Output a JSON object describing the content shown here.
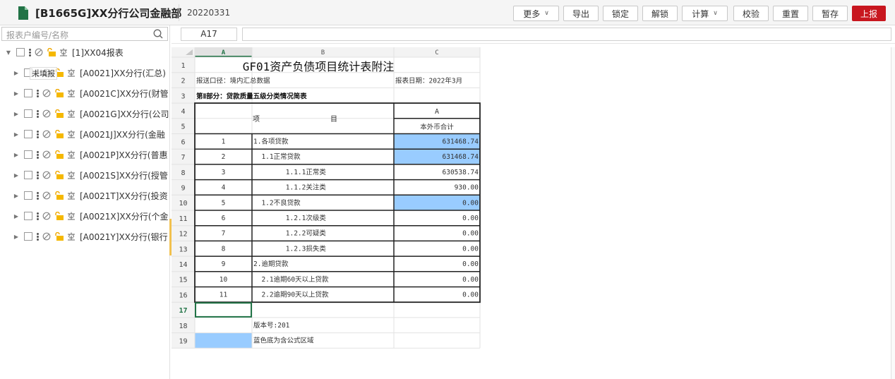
{
  "header": {
    "title": "[B1665G]XX分行公司金融部",
    "period": "20220331",
    "buttons": {
      "more": "更多",
      "export": "导出",
      "lock": "锁定",
      "unlock": "解锁",
      "calculate": "计算",
      "validate": "校验",
      "reset": "重置",
      "save": "暂存",
      "submit": "上报"
    }
  },
  "sidebar": {
    "search_placeholder": "报表户编号/名称",
    "tooltip": "未填报",
    "nodes": [
      {
        "label": "[1]XX04报表",
        "expanded": true
      },
      {
        "label": "[A0021]XX分行(汇总)"
      },
      {
        "label": "[A0021C]XX分行(财管"
      },
      {
        "label": "[A0021G]XX分行(公司"
      },
      {
        "label": "[A0021J]XX分行(金融"
      },
      {
        "label": "[A0021P]XX分行(普惠"
      },
      {
        "label": "[A0021S]XX分行(授管"
      },
      {
        "label": "[A0021T]XX分行(投资"
      },
      {
        "label": "[A0021X]XX分行(个金"
      },
      {
        "label": "[A0021Y]XX分行(银行"
      }
    ]
  },
  "formula_bar": {
    "cell_ref": "A17",
    "formula": ""
  },
  "sheet": {
    "columns": [
      "A",
      "B",
      "C"
    ],
    "title": "GF01资产负债项目统计表附注",
    "report_caliber": "报送口径：境内汇总数据",
    "report_date": "报表日期：2022年3月",
    "section": "第Ⅱ部分：贷款质量五级分类情况简表",
    "header_item_left": "项",
    "header_item_right": "目",
    "header_col_code": "A",
    "header_col_name": "本外币合计",
    "data_rows": [
      {
        "row": "6",
        "seq": "1",
        "item": "1.各项贷款",
        "value": "631468.74",
        "formula": true
      },
      {
        "row": "7",
        "seq": "2",
        "item": "  1.1正常贷款",
        "value": "631468.74",
        "formula": true
      },
      {
        "row": "8",
        "seq": "3",
        "item": "        1.1.1正常类",
        "value": "630538.74",
        "formula": false
      },
      {
        "row": "9",
        "seq": "4",
        "item": "        1.1.2关注类",
        "value": "930.00",
        "formula": false
      },
      {
        "row": "10",
        "seq": "5",
        "item": "  1.2不良贷款",
        "value": "0.00",
        "formula": true
      },
      {
        "row": "11",
        "seq": "6",
        "item": "        1.2.1次级类",
        "value": "0.00",
        "formula": false
      },
      {
        "row": "12",
        "seq": "7",
        "item": "        1.2.2可疑类",
        "value": "0.00",
        "formula": false
      },
      {
        "row": "13",
        "seq": "8",
        "item": "        1.2.3损失类",
        "value": "0.00",
        "formula": false
      },
      {
        "row": "14",
        "seq": "9",
        "item": "2.逾期贷款",
        "value": "0.00",
        "formula": false
      },
      {
        "row": "15",
        "seq": "10",
        "item": "  2.1逾期60天以上贷款",
        "value": "0.00",
        "formula": false
      },
      {
        "row": "16",
        "seq": "11",
        "item": "  2.2逾期90天以上贷款",
        "value": "0.00",
        "formula": false
      }
    ],
    "version": "版本号:201",
    "legend": "蓝色底为含公式区域",
    "active_row": "17",
    "colors": {
      "formula_fill": "#99ccff",
      "active_border": "#217346",
      "header_bg": "#f3f3f3"
    }
  }
}
